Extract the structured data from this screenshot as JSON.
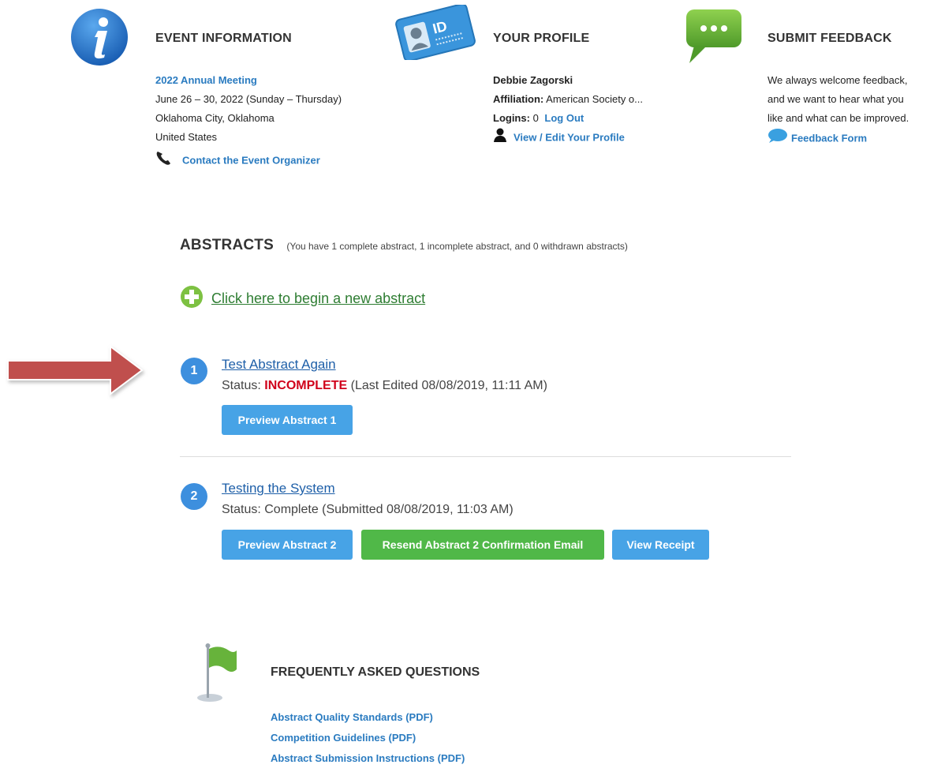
{
  "event": {
    "title": "EVENT INFORMATION",
    "meeting_link": "2022 Annual Meeting",
    "dates": "June 26 – 30, 2022 (Sunday – Thursday)",
    "city": "Oklahoma City, Oklahoma",
    "country": "United States",
    "contact_link": "Contact the Event Organizer",
    "icon": "info-icon"
  },
  "profile": {
    "title": "YOUR PROFILE",
    "name": "Debbie Zagorski",
    "affiliation_label": "Affiliation:",
    "affiliation_value": "American Society o...",
    "logins_label": "Logins:",
    "logins_value": "0",
    "logout_link": "Log Out",
    "edit_link": "View / Edit Your Profile",
    "id_text": "ID",
    "icon": "id-card-icon"
  },
  "feedback": {
    "title": "SUBMIT FEEDBACK",
    "line1": "We always welcome feedback,",
    "line2": "and we want to hear what you",
    "line3": "like and what can be improved.",
    "form_link": "Feedback Form",
    "icon": "speech-bubble-icon"
  },
  "abstracts": {
    "title": "ABSTRACTS",
    "summary": "(You have 1 complete abstract, 1 incomplete abstract, and 0 withdrawn abstracts)",
    "new_link": "Click here to begin a new abstract",
    "items": [
      {
        "number": "1",
        "title": "Test Abstract Again",
        "status_label": "Status:",
        "status_value": "INCOMPLETE",
        "status_detail": "(Last Edited 08/08/2019, 11:11 AM)",
        "preview_button": "Preview Abstract 1"
      },
      {
        "number": "2",
        "title": "Testing the System",
        "status_text": "Status: Complete (Submitted 08/08/2019, 11:03 AM)",
        "preview_button": "Preview Abstract 2",
        "resend_button": "Resend Abstract 2 Confirmation Email",
        "receipt_button": "View Receipt"
      }
    ]
  },
  "faq": {
    "title": "FREQUENTLY ASKED QUESTIONS",
    "links": [
      "Abstract Quality Standards (PDF)",
      "Competition Guidelines (PDF)",
      "Abstract Submission Instructions (PDF)"
    ],
    "icon": "green-flag-icon"
  },
  "colors": {
    "link_blue": "#2a7bc0",
    "button_blue": "#47a3e6",
    "button_green": "#50b848",
    "incomplete_red": "#d0021b",
    "arrow_red": "#c0504d"
  }
}
